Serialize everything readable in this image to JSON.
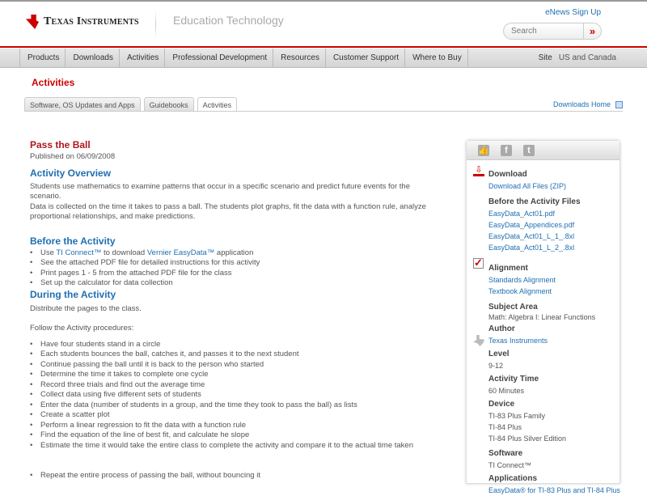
{
  "header": {
    "brand": "Texas Instruments",
    "section": "Education Technology",
    "enews": "eNews Sign Up",
    "search_placeholder": "Search",
    "search_go": "»"
  },
  "nav": {
    "items": [
      "Products",
      "Downloads",
      "Activities",
      "Professional Development",
      "Resources",
      "Customer Support",
      "Where to Buy"
    ],
    "site_label": "Site",
    "site_value": "US and Canada"
  },
  "page_heading": "Activities",
  "tabs": [
    "Software, OS Updates and Apps",
    "Guidebooks",
    "Activities"
  ],
  "downloads_home": "Downloads Home",
  "main": {
    "title": "Pass the Ball",
    "published": "Published on 06/09/2008",
    "overview_h": "Activity Overview",
    "overview_p1": "Students use mathematics to examine patterns that occur in a specific scenario and predict future events for the scenario.",
    "overview_p2": "Data is collected on the time it takes to pass a ball. The students plot graphs, fit the data with a function rule, analyze proportional relationships, and make predictions.",
    "before_h": "Before the Activity",
    "before_1a": "Use ",
    "before_1_link1": "TI Connect™",
    "before_1b": " to download ",
    "before_1_link2": "Vernier EasyData™",
    "before_1c": " application",
    "before_items": [
      "See the attached PDF file for detailed instructions for this activity",
      "Print pages 1 - 5 from the attached PDF file for the class",
      "Set up the calculator for data collection"
    ],
    "during_h": "During the Activity",
    "distribute": "Distribute the pages to the class.",
    "follow": "Follow the Activity procedures:",
    "during_items": [
      "Have four students stand in a circle",
      "Each students bounces the ball, catches it, and passes it to the next student",
      "Continue passing the ball until it is back to the person who started",
      "Determine the time it takes to complete one cycle",
      "Record three trials and find out the average time",
      "Collect data using five different sets of students",
      "Enter the data (number of students in a group, and the time they took to pass the ball) as lists",
      "Create a scatter plot",
      "Perform a linear regression to fit the data with a function rule",
      "Find the equation of the line of best fit, and calculate he slope",
      "Estimate the time it would take the entire class to complete the activity and compare it to the actual time taken"
    ],
    "repeat": "Repeat the entire process of passing the ball, without bouncing it"
  },
  "sidebar": {
    "download_h": "Download",
    "download_all": "Download All Files (ZIP)",
    "files_h": "Before the Activity Files",
    "files": [
      "EasyData_Act01.pdf",
      "EasyData_Appendices.pdf",
      "EasyData_Act01_L_1_.8xl",
      "EasyData_Act01_L_2_.8xl"
    ],
    "alignment_h": "Alignment",
    "alignment": [
      "Standards Alignment",
      "Textbook Alignment"
    ],
    "subject_h": "Subject Area",
    "subject": "Math: Algebra I: Linear Functions",
    "author_h": "Author",
    "author": "Texas Instruments",
    "level_h": "Level",
    "level": "9-12",
    "time_h": "Activity Time",
    "time": "60 Minutes",
    "device_h": "Device",
    "devices": [
      "TI-83 Plus Family",
      "TI-84 Plus",
      "TI-84 Plus Silver Edition"
    ],
    "software_h": "Software",
    "software": "TI Connect™",
    "apps_h": "Applications",
    "apps": "EasyData® for TI-83 Plus and TI-84 Plus"
  }
}
